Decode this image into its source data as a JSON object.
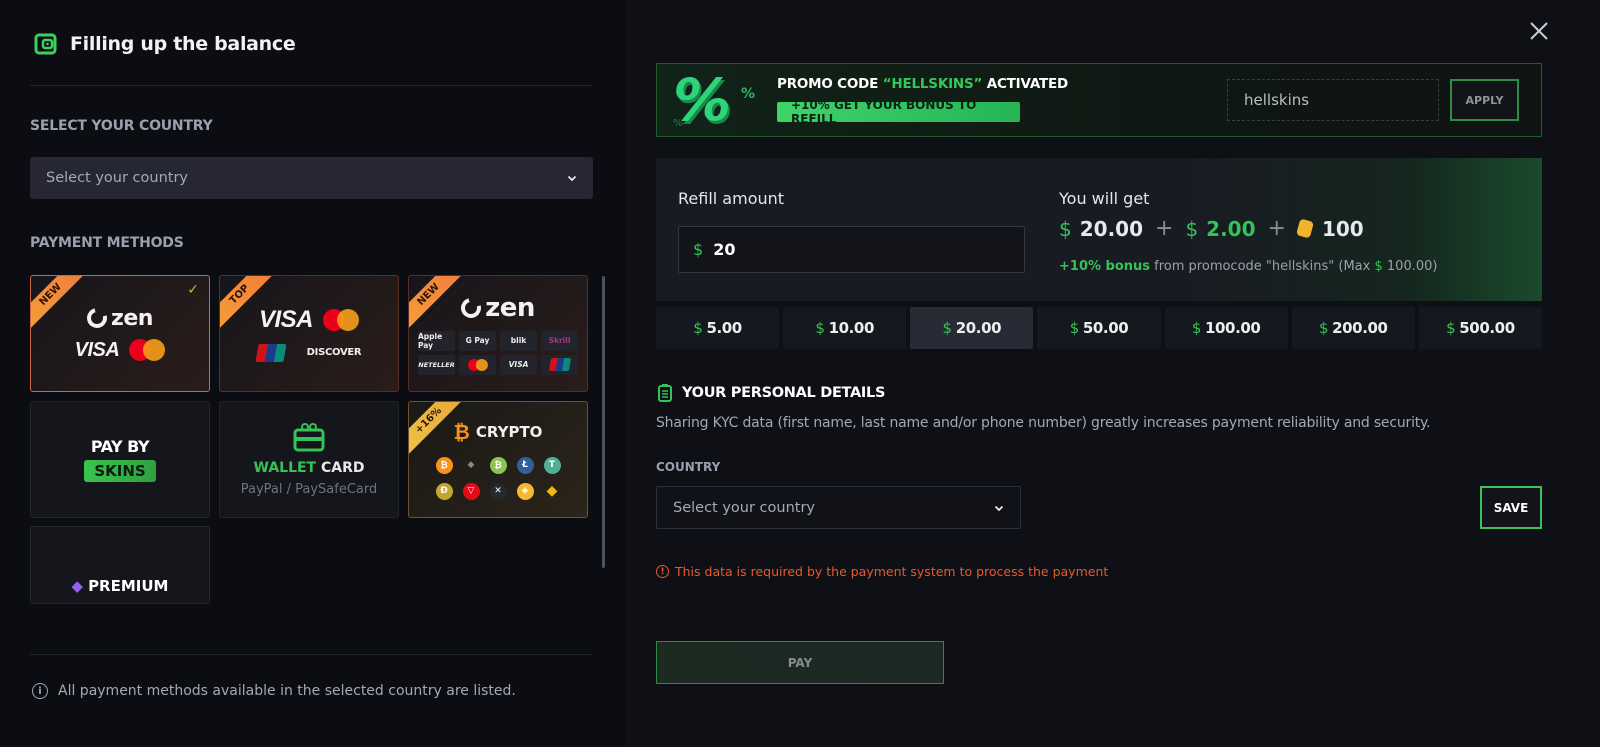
{
  "header": {
    "title": "Filling up the balance"
  },
  "left": {
    "country_label": "SELECT YOUR COUNTRY",
    "country_select": {
      "placeholder": "Select your country"
    },
    "payment_methods_label": "PAYMENT METHODS",
    "methods": [
      {
        "id": "zen-card",
        "badge": "NEW",
        "selected": true,
        "brands": [
          "zen",
          "VISA",
          "mastercard"
        ]
      },
      {
        "id": "cards",
        "badge": "TOP",
        "selected": false,
        "brands": [
          "VISA",
          "mastercard",
          "UnionPay",
          "DISCOVER"
        ]
      },
      {
        "id": "zen-wallets",
        "badge": "NEW",
        "selected": false,
        "brands": [
          "zen"
        ],
        "mini": [
          "Apple Pay",
          "G Pay",
          "blik",
          "Skrill",
          "NETELLER",
          "mastercard",
          "VISA",
          "UnionPay"
        ]
      },
      {
        "id": "pay-by-skins",
        "line1": "PAY BY",
        "line2": "SKINS"
      },
      {
        "id": "wallet-card",
        "title_green": "WALLET",
        "title_white": "CARD",
        "subtitle": "PayPal / PaySafeCard"
      },
      {
        "id": "crypto",
        "badge": "+16%",
        "title": "CRYPTO",
        "coins": [
          "BTC",
          "ETH",
          "BCH",
          "LTC",
          "USDT",
          "DOGE",
          "TRX",
          "XRP",
          "BNB",
          "BUSD"
        ]
      },
      {
        "id": "premium",
        "title": "PREMIUM"
      }
    ],
    "info_text": "All payment methods available in the selected country are listed."
  },
  "promo": {
    "title_prefix": "PROMO CODE ",
    "code_display": "“HELLSKINS”",
    "title_suffix": " ACTIVATED",
    "badge": "+10% GET YOUR BONUS TO REFILL",
    "input_value": "hellskins",
    "apply_label": "APPLY"
  },
  "refill": {
    "label": "Refill amount",
    "currency": "$",
    "amount": "20",
    "you_get_label": "You will get",
    "base": "20.00",
    "bonus": "2.00",
    "coins": "100",
    "bonus_highlight": "+10% bonus",
    "bonus_text": " from promocode \"hellskins\" (Max ",
    "bonus_max": "100.00",
    "bonus_close": ")"
  },
  "presets": [
    {
      "value": "5.00",
      "active": false
    },
    {
      "value": "10.00",
      "active": false
    },
    {
      "value": "20.00",
      "active": true
    },
    {
      "value": "50.00",
      "active": false
    },
    {
      "value": "100.00",
      "active": false
    },
    {
      "value": "200.00",
      "active": false
    },
    {
      "value": "500.00",
      "active": false
    }
  ],
  "personal": {
    "title": "YOUR PERSONAL DETAILS",
    "description": "Sharing KYC data (first name, last name and/or phone number) greatly increases payment reliability and security.",
    "country_label": "COUNTRY",
    "country_placeholder": "Select your country",
    "save_label": "SAVE",
    "warning": "This data is required by the payment system to process the payment"
  },
  "pay_label": "PAY",
  "colors": {
    "accent": "#34c259",
    "warning": "#e8592c",
    "ribbon": "#f7a037"
  }
}
